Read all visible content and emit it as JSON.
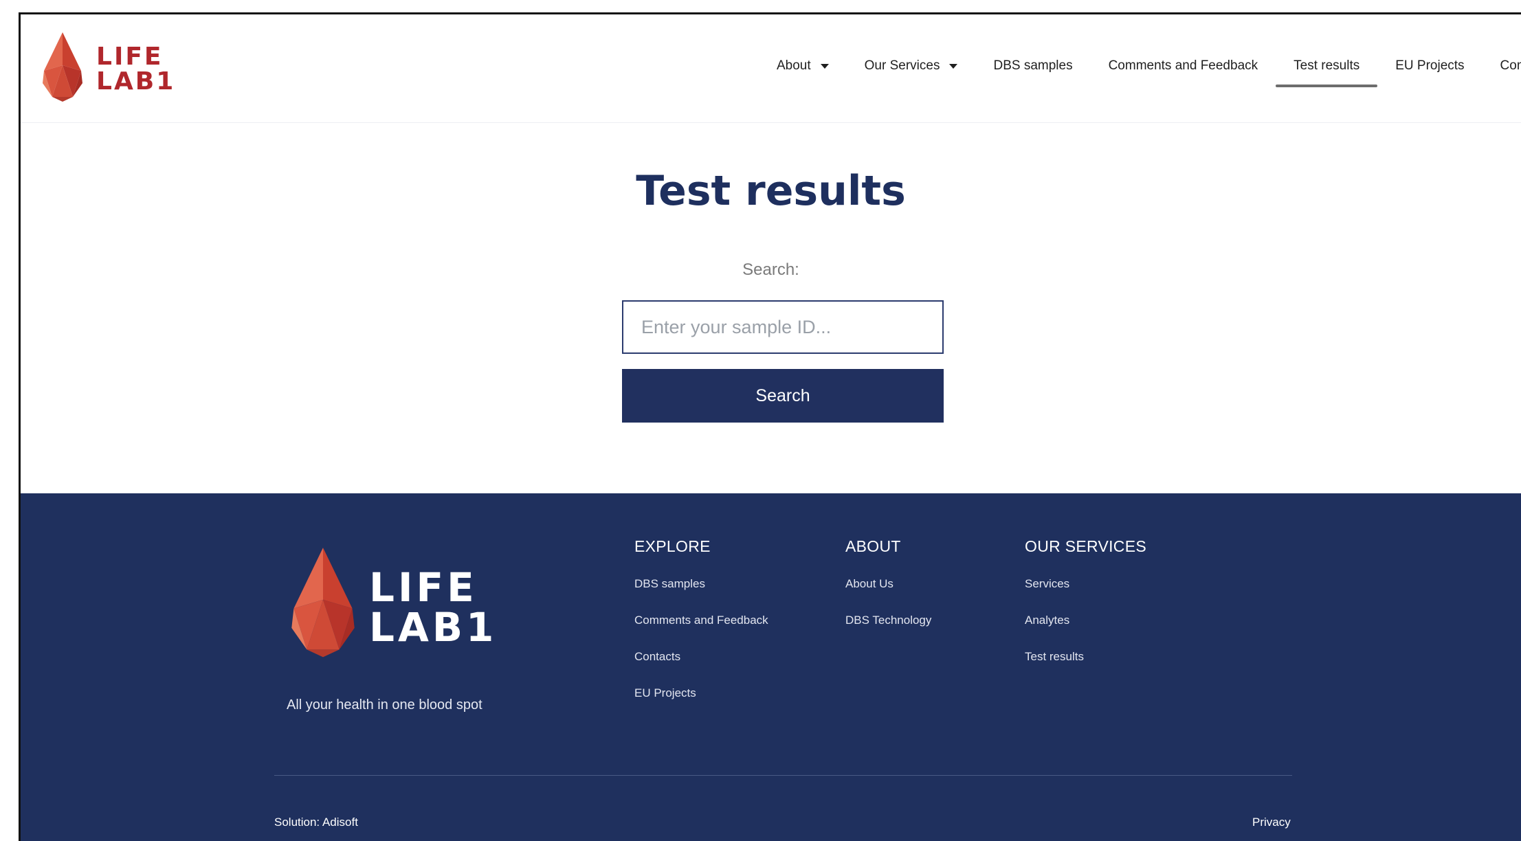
{
  "brand": {
    "line1": "LIFE",
    "line2": "LAB1",
    "logo_color": "#b0272c",
    "drop_color": "#d9553f"
  },
  "nav": {
    "items": [
      {
        "label": "About",
        "has_dropdown": true,
        "active": false
      },
      {
        "label": "Our Services",
        "has_dropdown": true,
        "active": false
      },
      {
        "label": "DBS samples",
        "has_dropdown": false,
        "active": false
      },
      {
        "label": "Comments and Feedback",
        "has_dropdown": false,
        "active": false
      },
      {
        "label": "Test results",
        "has_dropdown": false,
        "active": true
      },
      {
        "label": "EU Projects",
        "has_dropdown": false,
        "active": false
      },
      {
        "label": "Contacts",
        "has_dropdown": false,
        "active": false
      }
    ]
  },
  "main": {
    "title": "Test results",
    "search_label": "Search:",
    "search_placeholder": "Enter your sample ID...",
    "search_value": "",
    "search_button": "Search"
  },
  "footer": {
    "tagline": "All your health in one blood spot",
    "columns": [
      {
        "heading": "EXPLORE",
        "links": [
          "DBS samples",
          "Comments and Feedback",
          "Contacts",
          "EU Projects"
        ]
      },
      {
        "heading": "ABOUT",
        "links": [
          "About Us",
          "DBS Technology"
        ]
      },
      {
        "heading": "OUR SERVICES",
        "links": [
          "Services",
          "Analytes",
          "Test results"
        ]
      }
    ],
    "solution": "Solution: Adisoft",
    "privacy": "Privacy"
  },
  "colors": {
    "navy": "#1f305e",
    "button": "#21305f",
    "title": "#1e2f5e",
    "logo_red": "#b0272c"
  }
}
